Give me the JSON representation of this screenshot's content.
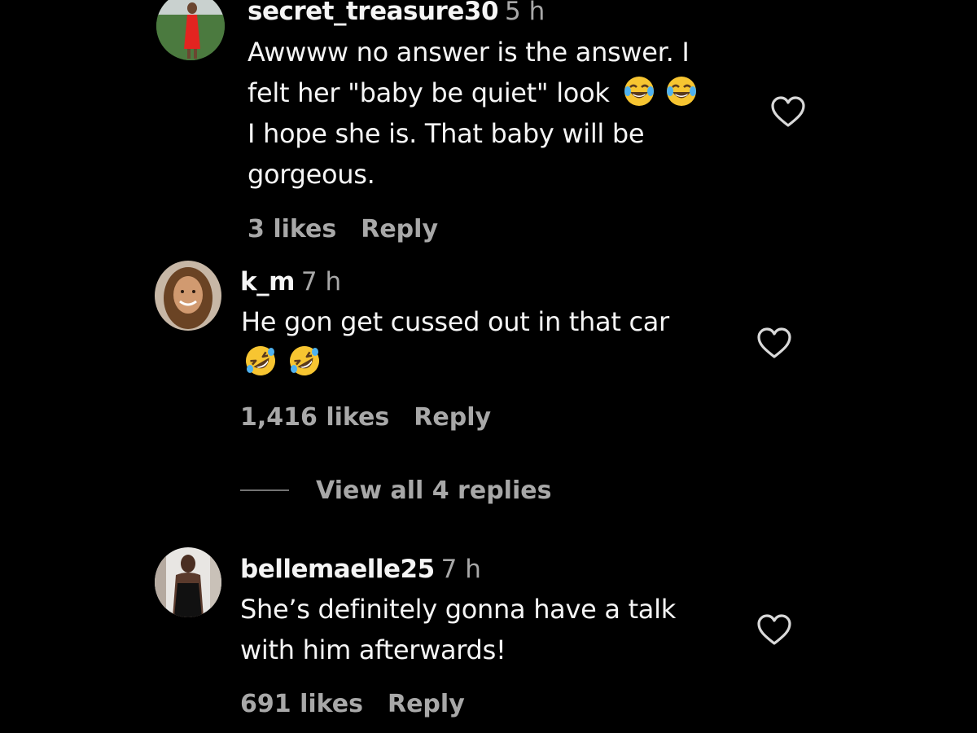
{
  "comments": [
    {
      "username": "secret_treasure30",
      "time": "5 h",
      "lines": [
        "Awwww no answer is the answer. I",
        "felt her \"baby be quiet\" look",
        "I hope she is. That baby will be",
        "gorgeous."
      ],
      "emoji": "face-with-tears-of-joy",
      "likes": "3 likes",
      "reply": "Reply"
    },
    {
      "username": "k_m",
      "time": "7 h",
      "lines": [
        "He gon get cussed out in that car"
      ],
      "emoji": "rolling-on-the-floor-laughing",
      "likes": "1,416 likes",
      "reply": "Reply",
      "view_replies": "View all 4 replies"
    },
    {
      "username": "bellemaelle25",
      "time": "7 h",
      "lines": [
        "She’s definitely gonna have a talk",
        "with him afterwards!"
      ],
      "likes": "691 likes",
      "reply": "Reply"
    }
  ],
  "colors": {
    "background": "#000000",
    "primary_text": "#f5f5f5",
    "secondary_text": "#a8a8a8",
    "emoji_yellow": "#f7c531"
  }
}
